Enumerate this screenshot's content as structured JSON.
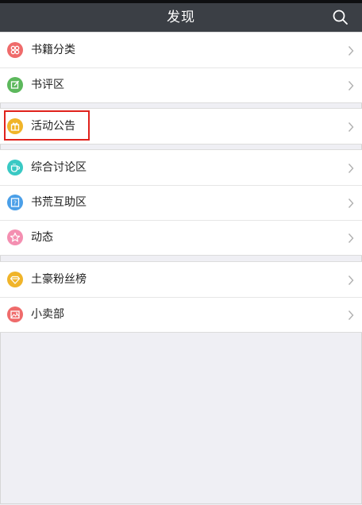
{
  "header": {
    "title": "发现",
    "search_icon": "search-icon"
  },
  "groups": [
    {
      "items": [
        {
          "label": "书籍分类",
          "icon": "book-category-icon",
          "color": "#ef6b6b"
        },
        {
          "label": "书评区",
          "icon": "review-icon",
          "color": "#5cb85c"
        }
      ]
    },
    {
      "items": [
        {
          "label": "活动公告",
          "icon": "gift-icon",
          "color": "#f0b429"
        }
      ]
    },
    {
      "items": [
        {
          "label": "综合讨论区",
          "icon": "coffee-icon",
          "color": "#39c9c4"
        },
        {
          "label": "书荒互助区",
          "icon": "help-icon",
          "color": "#4a9fe8"
        },
        {
          "label": "动态",
          "icon": "star-icon",
          "color": "#f48fb1"
        }
      ]
    },
    {
      "items": [
        {
          "label": "土豪粉丝榜",
          "icon": "diamond-icon",
          "color": "#f0b429"
        },
        {
          "label": "小卖部",
          "icon": "shop-icon",
          "color": "#ef6b6b"
        }
      ]
    }
  ],
  "highlight": {
    "target": "活动公告",
    "color": "#e0221c"
  }
}
